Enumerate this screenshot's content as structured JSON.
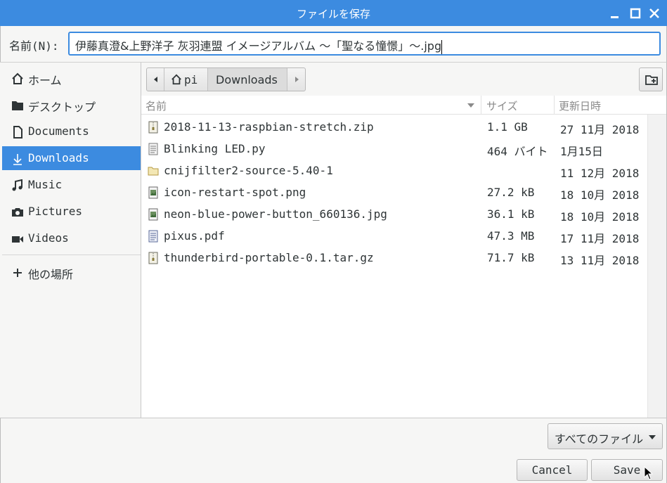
{
  "window": {
    "title": "ファイルを保存"
  },
  "name_row": {
    "label": "名前(N):",
    "value": "伊藤真澄&上野洋子 灰羽連盟 イメージアルバム 〜「聖なる憧憬」〜.jpg"
  },
  "sidebar": {
    "items": [
      {
        "label": "ホーム",
        "icon": "home-icon"
      },
      {
        "label": "デスクトップ",
        "icon": "folder-icon"
      },
      {
        "label": "Documents",
        "icon": "document-icon"
      },
      {
        "label": "Downloads",
        "icon": "download-icon"
      },
      {
        "label": "Music",
        "icon": "music-icon"
      },
      {
        "label": "Pictures",
        "icon": "camera-icon"
      },
      {
        "label": "Videos",
        "icon": "video-icon"
      }
    ],
    "other_locations": "他の場所"
  },
  "pathbar": {
    "segments": [
      "pi",
      "Downloads"
    ]
  },
  "list": {
    "columns": [
      "名前",
      "サイズ",
      "更新日時"
    ],
    "rows": [
      {
        "name": "2018-11-13-raspbian-stretch.zip",
        "size": "1.1 GB",
        "date": "27 11月 2018",
        "icon": "archive-icon"
      },
      {
        "name": "Blinking LED.py",
        "size": "464 バイト",
        "date": "1月15日",
        "icon": "text-file-icon"
      },
      {
        "name": "cnijfilter2-source-5.40-1",
        "size": "",
        "date": "11 12月 2018",
        "icon": "folder-icon"
      },
      {
        "name": "icon-restart-spot.png",
        "size": "27.2 kB",
        "date": "18 10月 2018",
        "icon": "image-file-icon"
      },
      {
        "name": "neon-blue-power-button_660136.jpg",
        "size": "36.1 kB",
        "date": "18 10月 2018",
        "icon": "image-file-icon"
      },
      {
        "name": "pixus.pdf",
        "size": "47.3 MB",
        "date": "17 11月 2018",
        "icon": "pdf-file-icon"
      },
      {
        "name": "thunderbird-portable-0.1.tar.gz",
        "size": "71.7 kB",
        "date": "13 11月 2018",
        "icon": "archive-icon"
      }
    ]
  },
  "filter": {
    "label": "すべてのファイル"
  },
  "buttons": {
    "cancel": "Cancel",
    "save": "Save"
  },
  "colors": {
    "accent": "#3c8be0"
  }
}
